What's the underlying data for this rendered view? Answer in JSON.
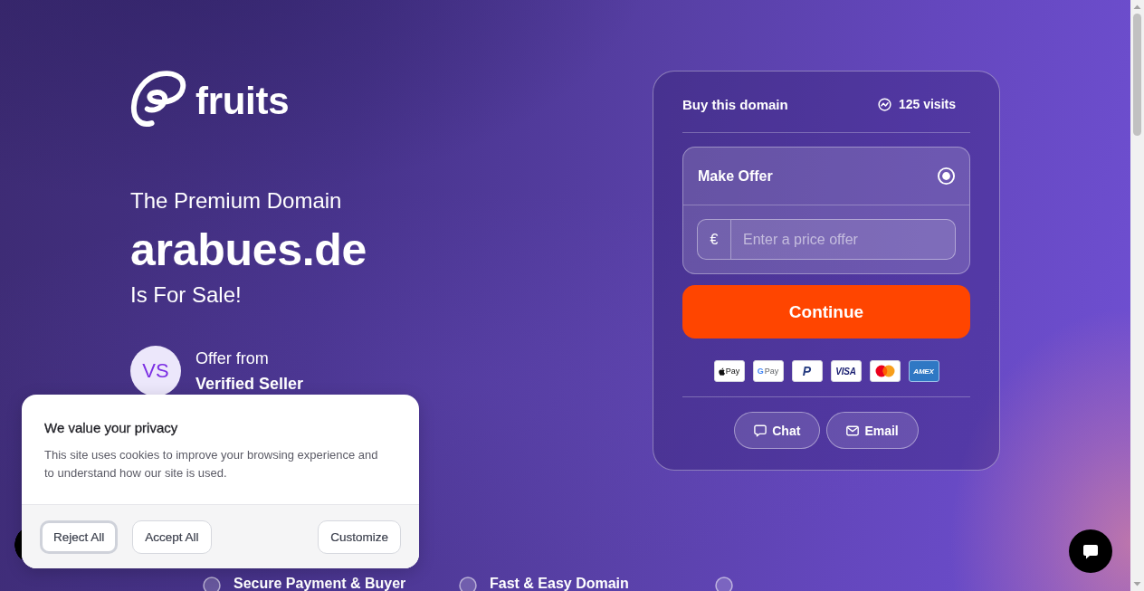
{
  "logo": {
    "name": "fruits"
  },
  "hero": {
    "eyebrow": "The Premium Domain",
    "domain": "arabues.de",
    "tagline": "Is For Sale!"
  },
  "seller": {
    "initials": "VS",
    "line_1": "Offer from",
    "line_2": "Verified Seller"
  },
  "buy_card": {
    "title": "Buy this domain",
    "visits": "125 visits",
    "options": [
      {
        "label": "Make Offer",
        "selected": true,
        "currency": "€",
        "placeholder": "Enter a price offer"
      }
    ],
    "primary_button": "Continue",
    "payment_methods": [
      {
        "kind": "apple_pay",
        "label": "Pay"
      },
      {
        "kind": "google_pay",
        "logo_letter": "G",
        "label": "Pay"
      },
      {
        "kind": "paypal",
        "logo_letter": "P"
      },
      {
        "kind": "visa",
        "label": "VISA"
      },
      {
        "kind": "mastercard"
      },
      {
        "kind": "amex",
        "label": "AMEX"
      }
    ],
    "contact_buttons": [
      {
        "kind": "chat",
        "label": "Chat"
      },
      {
        "kind": "email",
        "label": "Email"
      }
    ]
  },
  "features": [
    {
      "kind": "titled",
      "title": "Secure Payment & Buyer"
    },
    {
      "kind": "titled",
      "title": "Fast & Easy Domain"
    },
    {
      "kind": "icon_only"
    }
  ],
  "cookie_banner": {
    "title": "We value your privacy",
    "text": "This site uses cookies to improve your browsing experience and to understand how our site is used.",
    "buttons": [
      {
        "label": "Reject All",
        "focused": true
      },
      {
        "label": "Accept All",
        "focused": false
      },
      {
        "label": "Customize",
        "focused": false
      }
    ]
  }
}
